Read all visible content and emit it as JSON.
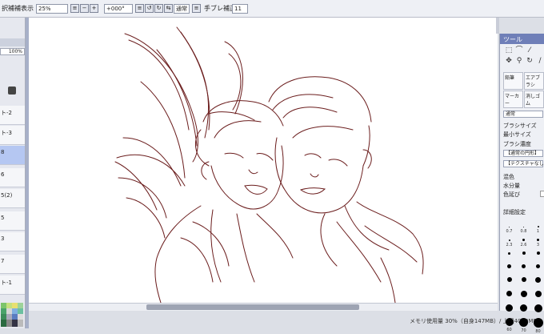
{
  "toolbar": {
    "display_label": "択補補表示",
    "zoom": "25%",
    "rotation": "+000°",
    "blend_mode": "通常",
    "stabilizer_label": "手ブレ補正",
    "stabilizer_value": "11"
  },
  "layers": {
    "opacity": "100%",
    "rows": [
      "ト-2",
      "ト-3",
      "8",
      "6",
      "5(2)",
      "5",
      "3",
      "7",
      "ト-1"
    ]
  },
  "tool_panel": {
    "title": "ツール",
    "brush_tiles": [
      "鉛筆",
      "エアブラシ",
      "マーカー",
      "消しゴム"
    ],
    "mode": "通常",
    "brush_size_label": "ブラシサイズ",
    "min_size_label": "最小サイズ",
    "brush_density_label": "ブラシ濃度",
    "shape": "【通常の円形】",
    "texture": "【テクスチャなし】",
    "blend_label": "混色",
    "water_label": "水分量",
    "stretch_label": "色延び",
    "detail_label": "詳細設定",
    "dot_sizes": [
      "0.7",
      "0.8",
      "1",
      "2.3",
      "2.6",
      "3",
      "",
      "",
      "",
      "",
      "",
      "",
      "",
      "",
      "",
      "",
      "",
      "",
      "",
      "",
      "",
      "60",
      "70",
      "80"
    ]
  },
  "status": {
    "memory": "メモリ使用量 30%（自身147MB）/ 上限4010MB)"
  },
  "colors": {
    "accent": "#6f7fb8",
    "selection": "#b5c7f2",
    "ink": "#6b1d1d"
  }
}
